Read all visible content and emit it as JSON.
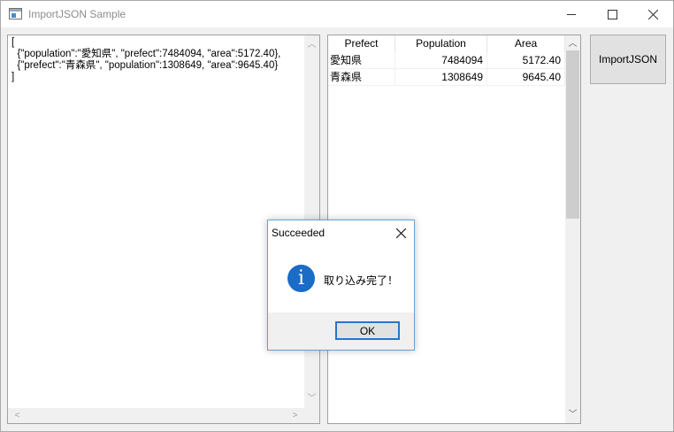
{
  "window": {
    "title": "ImportJSON Sample",
    "controls": {
      "minimize_icon": "minimize-icon",
      "maximize_icon": "maximize-icon",
      "close_icon": "close-icon"
    }
  },
  "json_editor": {
    "lines": [
      "[",
      "  {\"population\":\"愛知県\", \"prefect\":7484094, \"area\":5172.40},",
      "  {\"prefect\":\"青森県\", \"population\":1308649, \"area\":9645.40}",
      "]"
    ],
    "scroll_up": "︿",
    "scroll_down": "﹀",
    "scroll_left": "<",
    "scroll_right": ">"
  },
  "grid": {
    "columns": [
      "Prefect",
      "Population",
      "Area"
    ],
    "rows": [
      {
        "prefect": "愛知県",
        "population": "7484094",
        "area": "5172.40"
      },
      {
        "prefect": "青森県",
        "population": "1308649",
        "area": "9645.40"
      }
    ],
    "scroll_up": "︿",
    "scroll_down": "﹀"
  },
  "import_button": {
    "label": "ImportJSON"
  },
  "dialog": {
    "title": "Succeeded",
    "message": "取り込み完了！",
    "icon": "info-icon",
    "icon_glyph": "i",
    "ok_label": "OK",
    "accent_color": "#1a6cc7"
  }
}
